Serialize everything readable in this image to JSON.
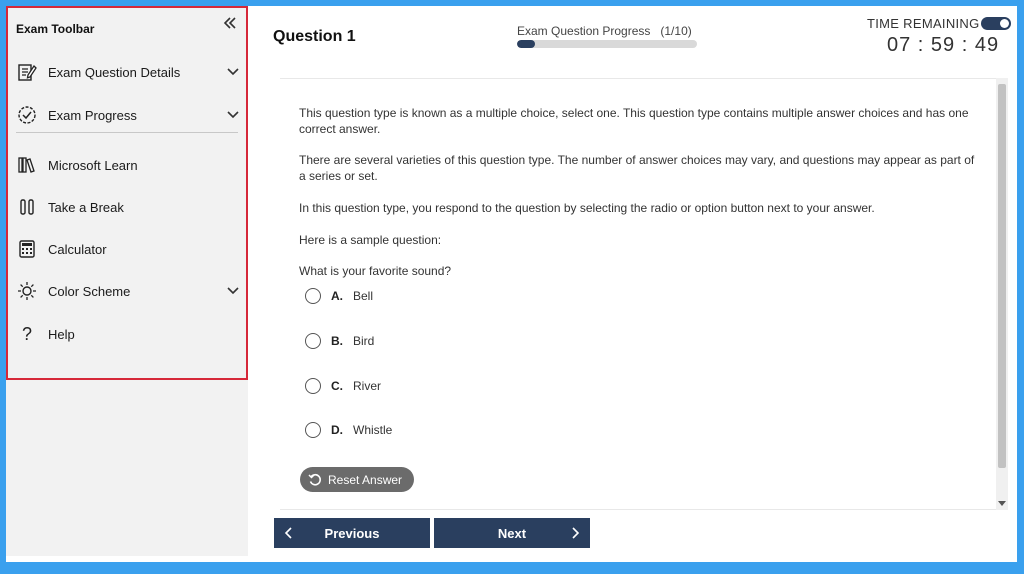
{
  "sidebar": {
    "title": "Exam Toolbar",
    "collapse_icon": "double-chevron-left-icon",
    "items": [
      {
        "label": "Exam Question Details",
        "icon": "edit-icon",
        "expandable": true
      },
      {
        "label": "Exam Progress",
        "icon": "check-circle-icon",
        "expandable": true
      },
      {
        "label": "Microsoft Learn",
        "icon": "books-icon",
        "expandable": false
      },
      {
        "label": "Take a Break",
        "icon": "pause-icon",
        "expandable": false
      },
      {
        "label": "Calculator",
        "icon": "calculator-icon",
        "expandable": false
      },
      {
        "label": "Color Scheme",
        "icon": "sun-icon",
        "expandable": true
      },
      {
        "label": "Help",
        "icon": "question-icon",
        "expandable": false
      }
    ]
  },
  "header": {
    "question_title": "Question 1",
    "progress_label": "Exam Question Progress",
    "progress_count": "(1/10)",
    "progress_fraction": 0.1,
    "time_label": "TIME REMAINING",
    "time_value": "07 : 59 : 49"
  },
  "content": {
    "paragraphs": [
      "This question type is known as a multiple choice, select one. This question type contains multiple answer choices and has one correct answer.",
      "There are several varieties of this question type. The number of answer choices may vary, and questions may appear as part of a series or set.",
      "In this question type, you respond to the question by selecting the radio or option button next to your answer.",
      "Here is a sample question:",
      "What is your favorite sound?"
    ],
    "options": [
      {
        "letter": "A.",
        "text": "Bell"
      },
      {
        "letter": "B.",
        "text": "Bird"
      },
      {
        "letter": "C.",
        "text": "River"
      },
      {
        "letter": "D.",
        "text": "Whistle"
      }
    ],
    "reset_label": "Reset Answer"
  },
  "nav": {
    "previous_label": "Previous",
    "next_label": "Next"
  },
  "colors": {
    "frame": "#3aa0ee",
    "highlight": "#d62839",
    "primary": "#2a3f5f",
    "reset": "#6b6b6b"
  }
}
